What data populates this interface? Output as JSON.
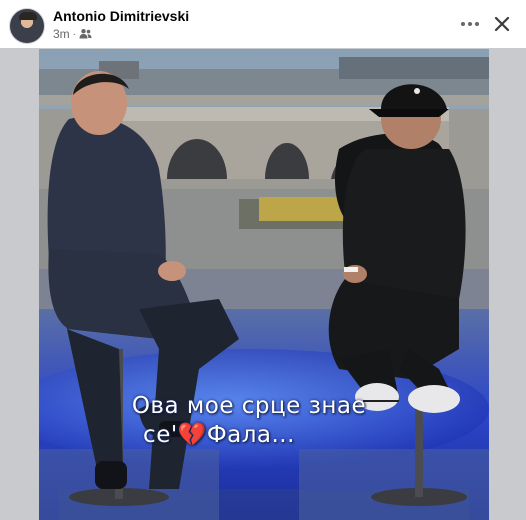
{
  "post": {
    "author": "Antonio Dimitrievski",
    "time": "3m",
    "separator": "·",
    "audience_icon": "friends-icon"
  },
  "header_actions": {
    "more_icon": "more-horizontal-icon",
    "close_icon": "close-icon"
  },
  "video": {
    "caption_line1": "Ова мое срце знае",
    "caption_line2_pre": "се'",
    "caption_heart": "💔",
    "caption_line2_post": "Фала..."
  }
}
